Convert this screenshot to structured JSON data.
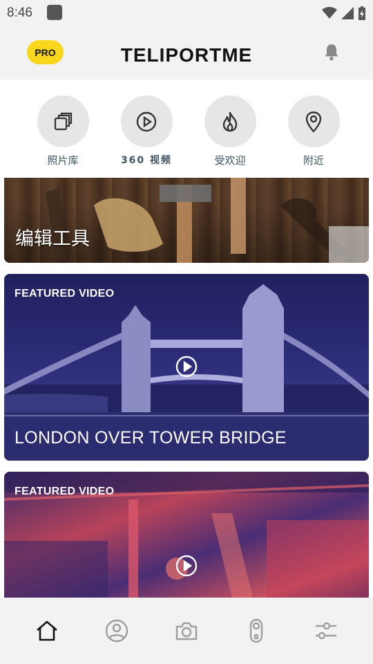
{
  "status": {
    "time": "8:46"
  },
  "header": {
    "pro_label": "PRO",
    "title": "TELIPORTME"
  },
  "categories": [
    {
      "label": "照片库",
      "icon": "gallery-icon"
    },
    {
      "label": "360 视频",
      "icon": "play-circle-icon"
    },
    {
      "label": "受欢迎",
      "icon": "flame-icon"
    },
    {
      "label": "附近",
      "icon": "location-pin-icon"
    }
  ],
  "cards": {
    "tools": {
      "title": "编辑工具"
    },
    "london": {
      "badge": "FEATURED VIDEO",
      "title": "LONDON OVER TOWER BRIDGE"
    },
    "market": {
      "badge": "FEATURED VIDEO"
    }
  },
  "nav": {
    "items": [
      "home-icon",
      "profile-icon",
      "camera-icon",
      "360-camera-icon",
      "settings-sliders-icon"
    ],
    "active_color": "#111111",
    "inactive_color": "#9e9e9e"
  },
  "colors": {
    "pro_yellow": "#f9d71c",
    "circle_bg": "#e6e6e6",
    "label_color": "#3d5560"
  }
}
